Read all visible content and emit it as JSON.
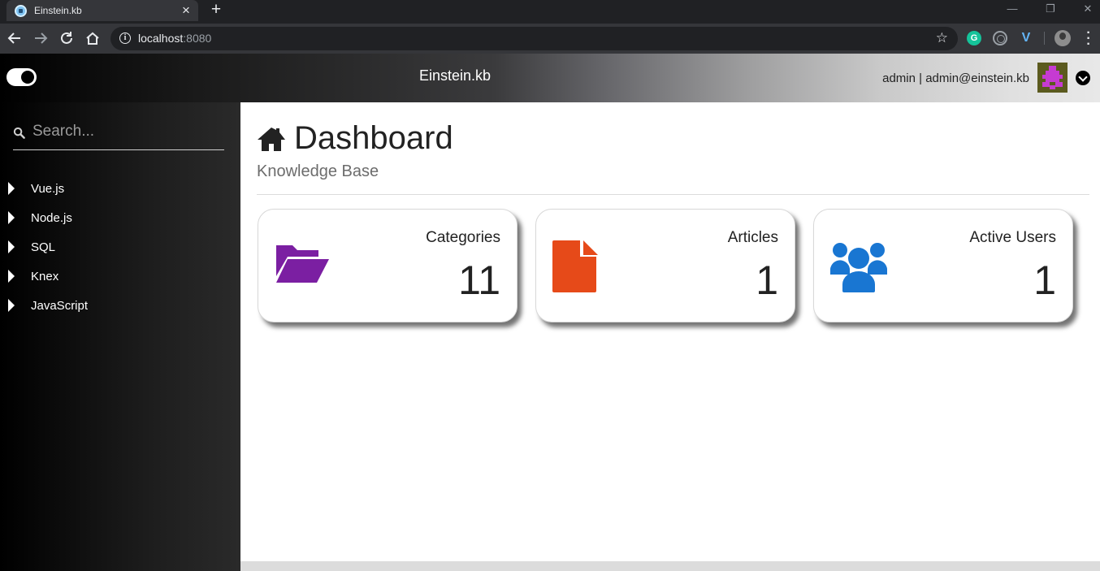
{
  "browser": {
    "tab_title": "Einstein.kb",
    "tab_close": "×",
    "new_tab": "+",
    "url_host": "localhost",
    "url_port": ":8080",
    "extension_g": "G",
    "extension_v": "V",
    "window_controls": [
      "—",
      "❐",
      "✕"
    ]
  },
  "header": {
    "title": "Einstein.kb",
    "user_text": "admin | admin@einstein.kb",
    "gradient_colors": [
      "#000000",
      "#3b3b3d",
      "#e8e8e8"
    ]
  },
  "sidebar": {
    "search_placeholder": "Search...",
    "items": [
      {
        "label": "Vue.js"
      },
      {
        "label": "Node.js"
      },
      {
        "label": "SQL"
      },
      {
        "label": "Knex"
      },
      {
        "label": "JavaScript"
      }
    ]
  },
  "main": {
    "title": "Dashboard",
    "subtitle": "Knowledge Base",
    "stats": [
      {
        "label": "Categories",
        "value": "11",
        "icon": "folder-open-icon",
        "color": "#7b1fa2"
      },
      {
        "label": "Articles",
        "value": "1",
        "icon": "file-icon",
        "color": "#e64a19"
      },
      {
        "label": "Active Users",
        "value": "1",
        "icon": "users-icon",
        "color": "#1976d2"
      }
    ]
  }
}
